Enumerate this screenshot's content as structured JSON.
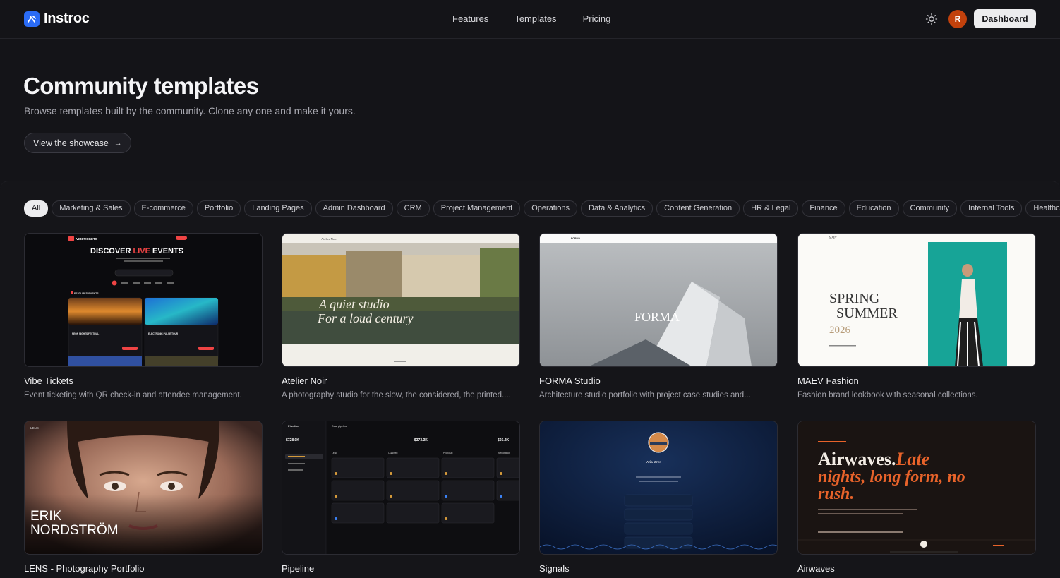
{
  "brand": {
    "name": "Instroc",
    "accent": "#2b6cf6"
  },
  "nav": {
    "links": [
      "Features",
      "Templates",
      "Pricing"
    ],
    "avatar_initial": "R",
    "dashboard_label": "Dashboard"
  },
  "hero": {
    "title": "Community templates",
    "subtitle": "Browse templates built by the community. Clone any one and make it yours.",
    "showcase_label": "View the showcase"
  },
  "filters": [
    "All",
    "Marketing & Sales",
    "E-commerce",
    "Portfolio",
    "Landing Pages",
    "Admin Dashboard",
    "CRM",
    "Project Management",
    "Operations",
    "Data & Analytics",
    "Content Generation",
    "HR & Legal",
    "Finance",
    "Education",
    "Community",
    "Internal Tools",
    "Healthca"
  ],
  "templates": [
    {
      "name": "Vibe Tickets",
      "desc": "Event ticketing with QR check-in and attendee management.",
      "preview": {
        "brand": "VIBETICKETS",
        "headline_a": "DISCOVER ",
        "headline_b": "LIVE",
        "headline_c": " EVENTS",
        "section": "FEATURED EVENTS",
        "event1": "NEON NIGHTS FESTIVAL",
        "event2": "ELECTRONIC PULSE TOUR"
      }
    },
    {
      "name": "Atelier Noir",
      "desc": "A photography studio for the slow, the considered, the printed....",
      "preview": {
        "brand": "Atelier Noir",
        "line1": "A quiet studio",
        "line2": "For a loud century"
      }
    },
    {
      "name": "FORMA Studio",
      "desc": "Architecture studio portfolio with project case studies and...",
      "preview": {
        "brand": "FORMA",
        "hero": "FORMA"
      }
    },
    {
      "name": "MAEV Fashion",
      "desc": "Fashion brand lookbook with seasonal collections.",
      "preview": {
        "brand": "MAEV",
        "line1": "SPRING",
        "line2": "SUMMER",
        "year": "2026"
      }
    },
    {
      "name": "LENS - Photography Portfolio",
      "desc": "",
      "preview": {
        "brand": "LENS",
        "line1": "ERIK",
        "line2": "NORDSTRÖM"
      }
    },
    {
      "name": "Pipeline",
      "desc": "",
      "preview": {
        "brand": "Pipeline",
        "board": "Deal pipeline",
        "amount1": "$728.0K",
        "amount2": "$373.3K",
        "amount3": "$66.2K",
        "cols": [
          "Lead",
          "Qualified",
          "Proposal",
          "Negotiation"
        ]
      }
    },
    {
      "name": "Signals",
      "desc": "",
      "preview": {
        "person": "Aria Wren"
      }
    },
    {
      "name": "Airwaves",
      "desc": "",
      "preview": {
        "h1": "Airwaves.",
        "h2": "Late",
        "h3": "nights, long form, no",
        "h4": "rush."
      }
    }
  ]
}
